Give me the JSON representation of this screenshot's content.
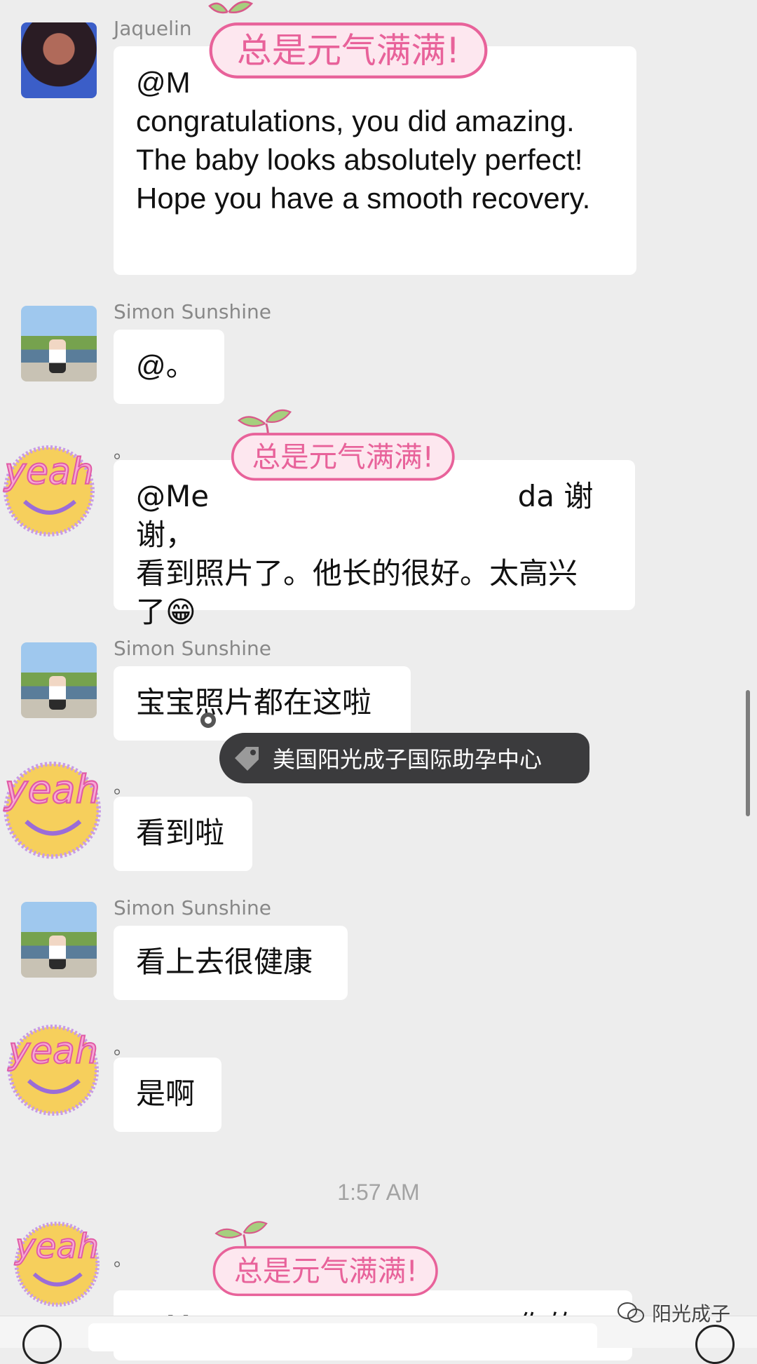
{
  "messages": [
    {
      "sender": "Jaquelin",
      "text": "@M\ncongratulations, you did amazing. The baby looks absolutely perfect! Hope you have a smooth recovery."
    },
    {
      "sender": "Simon Sunshine",
      "text": "@。"
    },
    {
      "sender": "。",
      "text": "@Me                                 da 谢谢，\n看到照片了。他长的很好。太高兴\n了😁"
    },
    {
      "sender": "Simon Sunshine",
      "text": "宝宝照片都在这啦"
    },
    {
      "sender": "。",
      "text": "看到啦"
    },
    {
      "sender": "Simon Sunshine",
      "text": "看上去很健康"
    },
    {
      "sender": "。",
      "text": "是啊"
    },
    {
      "sender": "。",
      "text": "@M                                a 你的"
    }
  ],
  "timestamp": "1:57 AM",
  "tag_label": "美国阳光成子国际助孕中心",
  "sticker_text": "总是元气满满!",
  "yeah_text": "yeah",
  "watermark": "阳光成子",
  "icons": [
    "tag-icon",
    "wechat-logo-icon",
    "voice-icon",
    "emoji-icon"
  ],
  "colors": {
    "background": "#ededed",
    "bubble": "#ffffff",
    "tag": "#3b3b3d",
    "sticker_pink": "#e8629a"
  }
}
